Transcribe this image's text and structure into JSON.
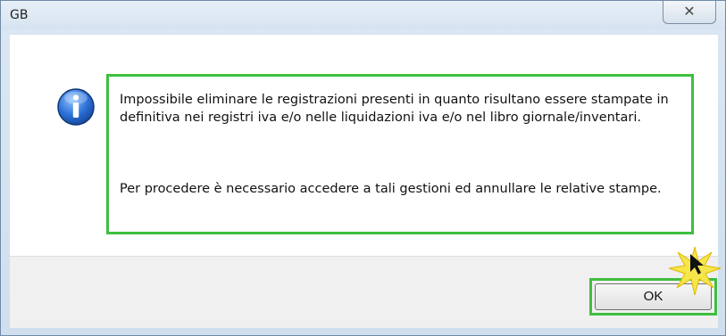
{
  "window": {
    "title": "GB",
    "close_glyph": "✕"
  },
  "message": {
    "paragraph_1": "Impossibile eliminare le registrazioni presenti in quanto risultano essere stampate in definitiva nei registri iva e/o nelle liquidazioni iva e/o nel libro giornale/inventari.",
    "paragraph_2": "Per procedere è necessario accedere a tali gestioni ed annullare le relative stampe."
  },
  "buttons": {
    "ok_label": "OK"
  },
  "icons": {
    "message_icon": "info-icon",
    "highlight_marker": "starburst-cursor-icon"
  },
  "colors": {
    "highlight": "#3fbf3f",
    "info_icon": "#1d5fc4",
    "burst": "#f5e64a"
  }
}
